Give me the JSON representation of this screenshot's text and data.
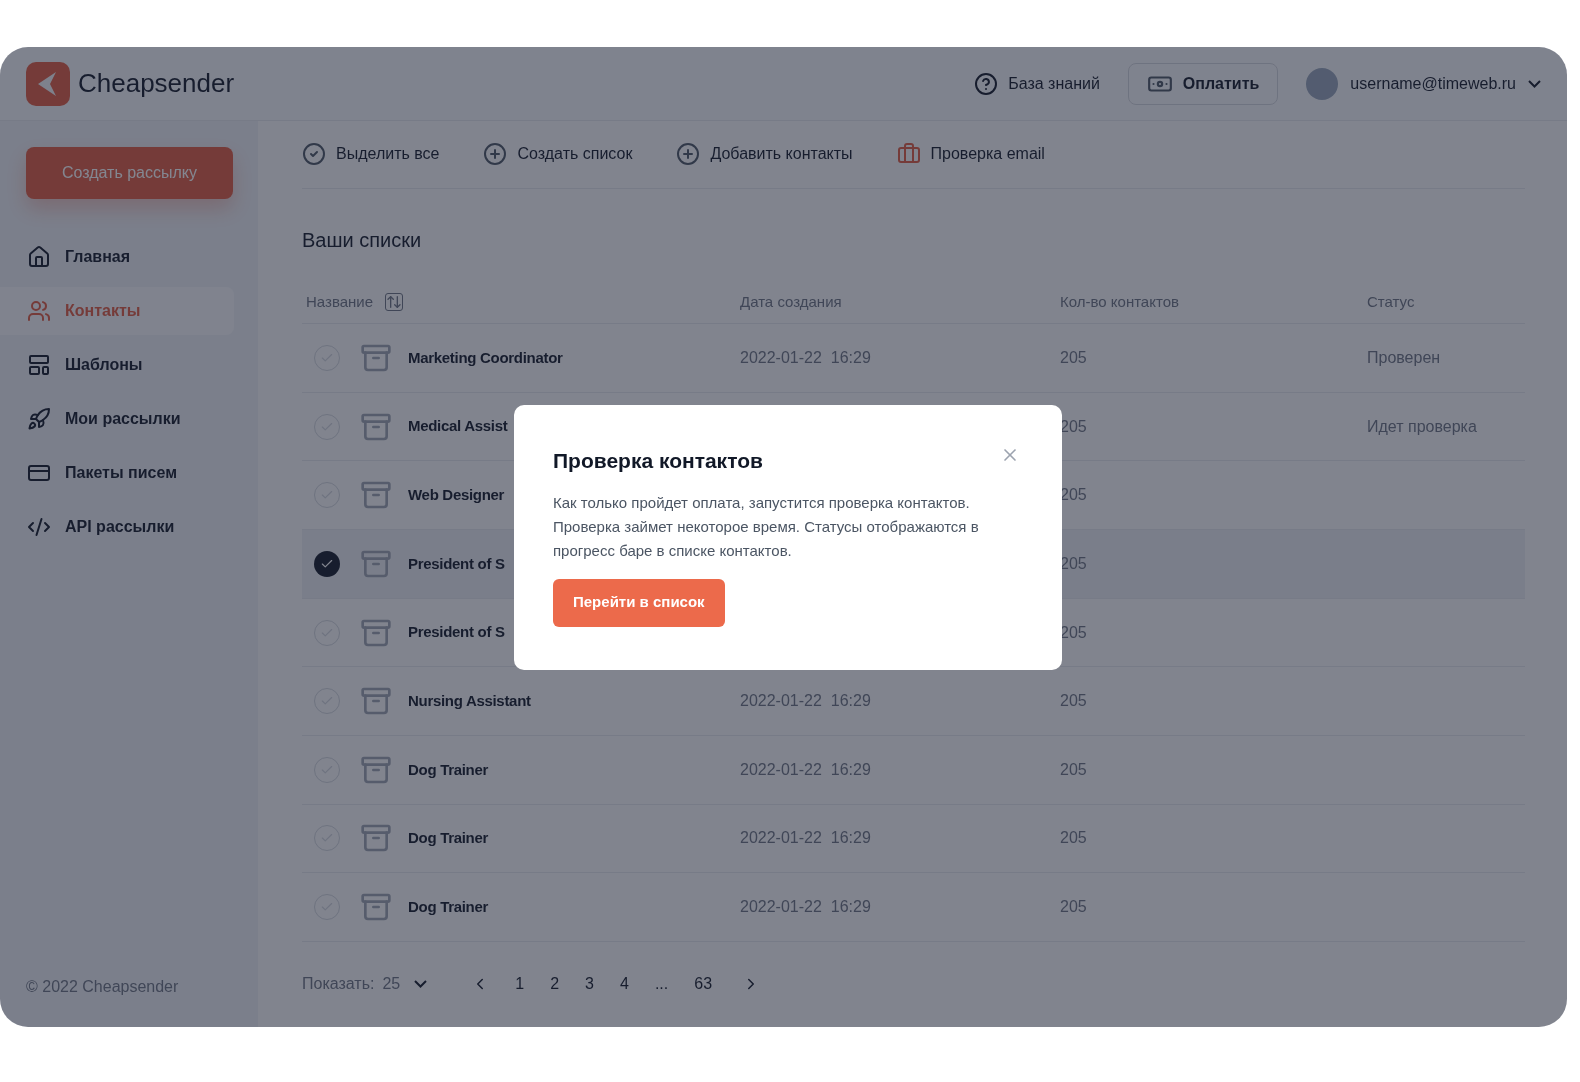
{
  "brand": {
    "name": "Cheapsender"
  },
  "header": {
    "help": "База знаний",
    "pay": "Оплатить",
    "user": "username@timeweb.ru"
  },
  "sidebar": {
    "create_button": "Создать рассылку",
    "items": [
      {
        "label": "Главная",
        "selected": false
      },
      {
        "label": "Контакты",
        "selected": true
      },
      {
        "label": "Шаблоны",
        "selected": false
      },
      {
        "label": "Мои рассылки",
        "selected": false
      },
      {
        "label": "Пакеты писем",
        "selected": false
      },
      {
        "label": "API рассылки",
        "selected": false
      }
    ],
    "footer": "© 2022 Cheapsender"
  },
  "toolbar": [
    "Выделить все",
    "Создать список",
    "Добавить контакты",
    "Проверка email"
  ],
  "section_title": "Ваши списки",
  "table": {
    "columns": [
      "Название",
      "Дата создания",
      "Кол-во контактов",
      "Статус"
    ],
    "rows": [
      {
        "name": "Marketing Coordinator",
        "date": "2022-01-22  16:29",
        "count": "205",
        "status": "Проверен",
        "selected": false
      },
      {
        "name": "Medical Assist",
        "count": "205",
        "status": "Идет проверка",
        "selected": false
      },
      {
        "name": "Web Designer",
        "count": "205",
        "selected": false
      },
      {
        "name": "President of S",
        "count": "205",
        "selected": true
      },
      {
        "name": "President of S",
        "count": "205",
        "selected": false
      },
      {
        "name": "Nursing Assistant",
        "date": "2022-01-22  16:29",
        "count": "205",
        "selected": false
      },
      {
        "name": "Dog Trainer",
        "date": "2022-01-22  16:29",
        "count": "205",
        "selected": false
      },
      {
        "name": "Dog Trainer",
        "date": "2022-01-22  16:29",
        "count": "205",
        "selected": false
      },
      {
        "name": "Dog Trainer",
        "date": "2022-01-22  16:29",
        "count": "205",
        "selected": false
      }
    ]
  },
  "pagination": {
    "show_label": "Показать:",
    "page_size": "25",
    "pages": [
      "1",
      "2",
      "3",
      "4",
      "...",
      "63"
    ]
  },
  "modal": {
    "title": "Проверка контактов",
    "text": "Как только пройдет оплата, запустится проверка контактов. Проверка займет некоторое время. Статусы отображаются в прогресс баре в списке контактов.",
    "button": "Перейти в список"
  }
}
